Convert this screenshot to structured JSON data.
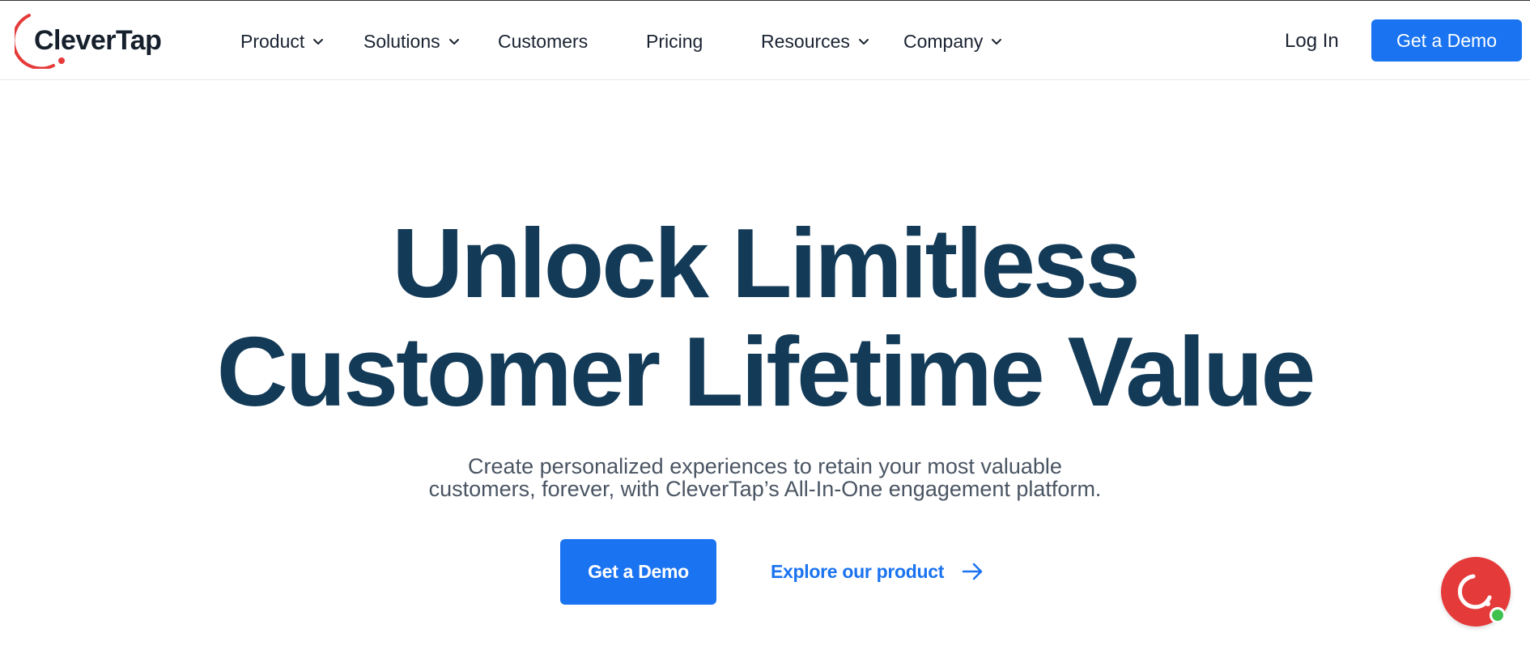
{
  "brand": {
    "name": "CleverTap",
    "accent_color": "#e53a3a",
    "primary_color": "#1a73f0",
    "heading_color": "#133a57"
  },
  "nav": {
    "items": [
      {
        "label": "Product",
        "has_dropdown": true
      },
      {
        "label": "Solutions",
        "has_dropdown": true
      },
      {
        "label": "Customers",
        "has_dropdown": false
      },
      {
        "label": "Pricing",
        "has_dropdown": false
      },
      {
        "label": "Resources",
        "has_dropdown": true
      },
      {
        "label": "Company",
        "has_dropdown": true
      }
    ],
    "login_label": "Log In",
    "demo_label": "Get a Demo"
  },
  "hero": {
    "title_line1": "Unlock Limitless",
    "title_line2": "Customer Lifetime Value",
    "subtitle_line1": "Create personalized experiences to retain your most valuable",
    "subtitle_line2": "customers, forever, with CleverTap’s All-In-One engagement platform.",
    "primary_cta": "Get a Demo",
    "secondary_cta": "Explore our product"
  },
  "icons": {
    "logo": "clevertap-logo-icon",
    "dropdown": "chevron-down-icon",
    "arrow": "arrow-right-icon",
    "chat": "chat-launcher-icon",
    "status": "online-status-icon"
  }
}
